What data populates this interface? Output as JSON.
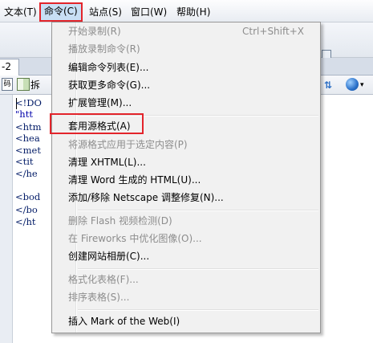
{
  "menubar": {
    "items": [
      {
        "label": "文本(T)"
      },
      {
        "label": "命令(C)"
      },
      {
        "label": "站点(S)"
      },
      {
        "label": "窗口(W)"
      },
      {
        "label": "帮助(H)"
      }
    ]
  },
  "tabstrip": {
    "doc_tab_label": "-2"
  },
  "doc_toolbar": {
    "code_label": "码",
    "split_label": "拆",
    "chevron": "▾"
  },
  "code_lines": [
    "<!DO                                                    nal//EN\"",
    "\"htt                                                   td\">",
    "<htm",
    "<hea",
    "<met                                                    arset=gb23",
    "<tit",
    "</he",
    "",
    "<bod",
    "</bo",
    "</ht"
  ],
  "command_menu": {
    "items": [
      {
        "label": "开始录制(R)",
        "shortcut": "Ctrl+Shift+X",
        "enabled": false
      },
      {
        "label": "播放录制命令(R)",
        "enabled": false
      },
      {
        "label": "编辑命令列表(E)...",
        "enabled": true
      },
      {
        "label": "获取更多命令(G)...",
        "enabled": true
      },
      {
        "label": "扩展管理(M)...",
        "enabled": true
      },
      {
        "label": "套用源格式(A)",
        "enabled": true,
        "highlighted": true
      },
      {
        "label": "将源格式应用于选定内容(P)",
        "enabled": false
      },
      {
        "label": "清理 XHTML(L)...",
        "enabled": true
      },
      {
        "label": "清理 Word 生成的 HTML(U)...",
        "enabled": true
      },
      {
        "label": "添加/移除 Netscape 调整修复(N)...",
        "enabled": true
      },
      {
        "label": "删除 Flash 视频检测(D)",
        "enabled": false
      },
      {
        "label": "在 Fireworks 中优化图像(O)...",
        "enabled": false
      },
      {
        "label": "创建网站相册(C)...",
        "enabled": true
      },
      {
        "label": "格式化表格(F)...",
        "enabled": false
      },
      {
        "label": "排序表格(S)...",
        "enabled": false
      },
      {
        "label": "插入 Mark of the Web(I)",
        "enabled": true
      }
    ]
  },
  "colors": {
    "highlight_border": "#e3242b",
    "disabled_text": "#8d8d8d",
    "menu_bg": "#f1f1f1"
  }
}
